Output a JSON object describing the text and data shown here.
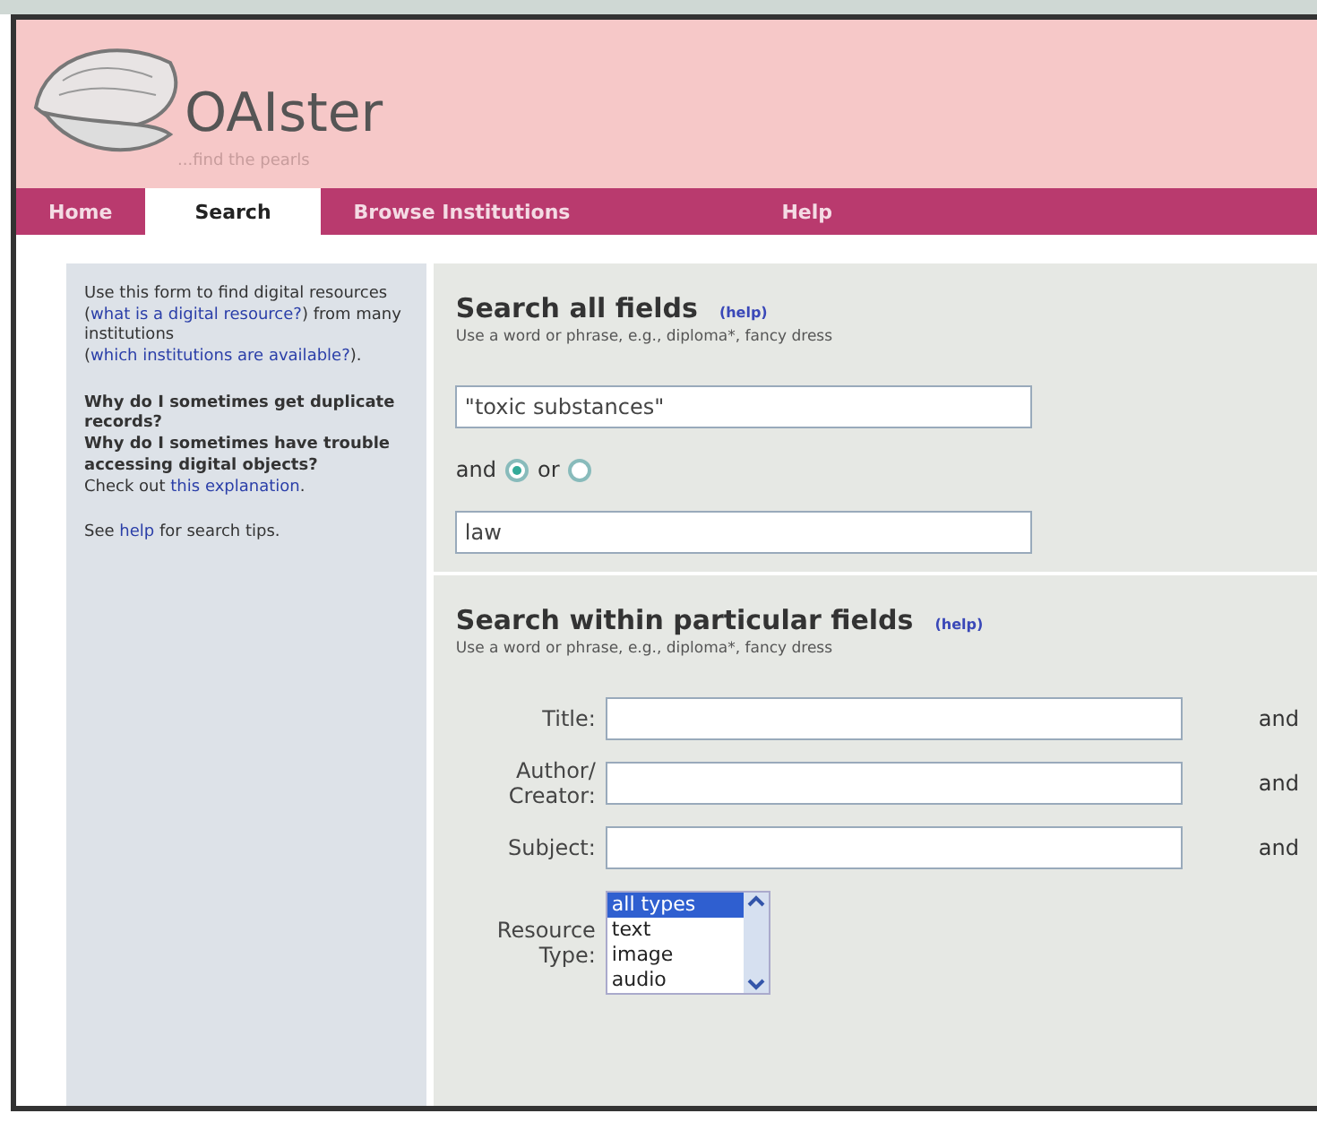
{
  "logo": {
    "name": "OAIster",
    "tagline": "...find the pearls"
  },
  "nav": [
    {
      "label": "Home",
      "selected": false
    },
    {
      "label": "Search",
      "selected": true
    },
    {
      "label": "Browse Institutions",
      "selected": false
    },
    {
      "label": "Help",
      "selected": false
    }
  ],
  "sidebar": {
    "paragraphs": [
      {
        "parts": [
          {
            "kind": "text",
            "text": "Use this form to find digital resources ("
          },
          {
            "kind": "link",
            "text": "what is a digital resource?"
          },
          {
            "kind": "text",
            "text": ") from many institutions ("
          },
          {
            "kind": "link",
            "text": "which institutions are available?"
          },
          {
            "kind": "text",
            "text": ")."
          }
        ]
      },
      {
        "parts": [
          {
            "kind": "bold",
            "text": "Why do I sometimes get duplicate records?"
          },
          {
            "kind": "bold",
            "text": "Why do I sometimes have trouble accessing digital objects?"
          },
          {
            "kind": "text",
            "text": "Check out "
          },
          {
            "kind": "link",
            "text": "this explanation"
          },
          {
            "kind": "text",
            "text": "."
          }
        ]
      },
      {
        "parts": [
          {
            "kind": "text",
            "text": "See "
          },
          {
            "kind": "link",
            "text": "help"
          },
          {
            "kind": "text",
            "text": " for search tips."
          }
        ]
      }
    ]
  },
  "search_all": {
    "title": "Search all fields",
    "help": "(help)",
    "hint": "Use a word or phrase, e.g., diploma*, fancy dress",
    "value_1": "\"toxic substances\"",
    "operators": [
      {
        "label": "and",
        "selected": true
      },
      {
        "label": "or",
        "selected": false
      }
    ],
    "value_2": "law"
  },
  "search_fields": {
    "title": "Search within particular fields",
    "help": "(help)",
    "hint": "Use a word or phrase, e.g., diploma*, fancy dress",
    "rows": [
      {
        "label": "Title:",
        "connector": "and"
      },
      {
        "label": "Author/ Creator:",
        "connector": "and"
      },
      {
        "label": "Subject:",
        "connector": "and"
      }
    ],
    "resource_type": {
      "label": "Resource Type:",
      "options": [
        {
          "label": "all types",
          "selected": true
        },
        {
          "label": "text",
          "selected": false
        },
        {
          "label": "image",
          "selected": false
        },
        {
          "label": "audio",
          "selected": false
        }
      ]
    }
  }
}
